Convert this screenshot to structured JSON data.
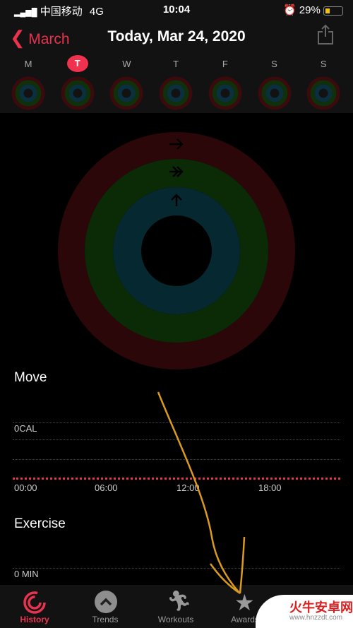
{
  "status": {
    "carrier": "中国移动",
    "network": "4G",
    "time": "10:04",
    "battery": "29%"
  },
  "header": {
    "back_label": "March",
    "title": "Today, Mar 24, 2020",
    "share_icon": "share-icon"
  },
  "week": {
    "days": [
      "M",
      "T",
      "W",
      "T",
      "F",
      "S",
      "S"
    ],
    "selected_index": 1
  },
  "rings": {
    "move_color": "#2b0709",
    "exercise_color": "#0b2a06",
    "stand_color": "#062830"
  },
  "move": {
    "label": "Move",
    "value": "0CAL",
    "times": [
      "00:00",
      "06:00",
      "12:00",
      "18:00"
    ]
  },
  "exercise": {
    "label": "Exercise",
    "value": "0 MIN"
  },
  "tabs": [
    {
      "label": "History",
      "active": true
    },
    {
      "label": "Trends"
    },
    {
      "label": "Workouts"
    },
    {
      "label": "Awards"
    }
  ],
  "watermark": {
    "text": "火牛安卓网",
    "url": "www.hnzzdt.com"
  },
  "colors": {
    "accent": "#e8334f",
    "annotation": "#d99a1e"
  }
}
